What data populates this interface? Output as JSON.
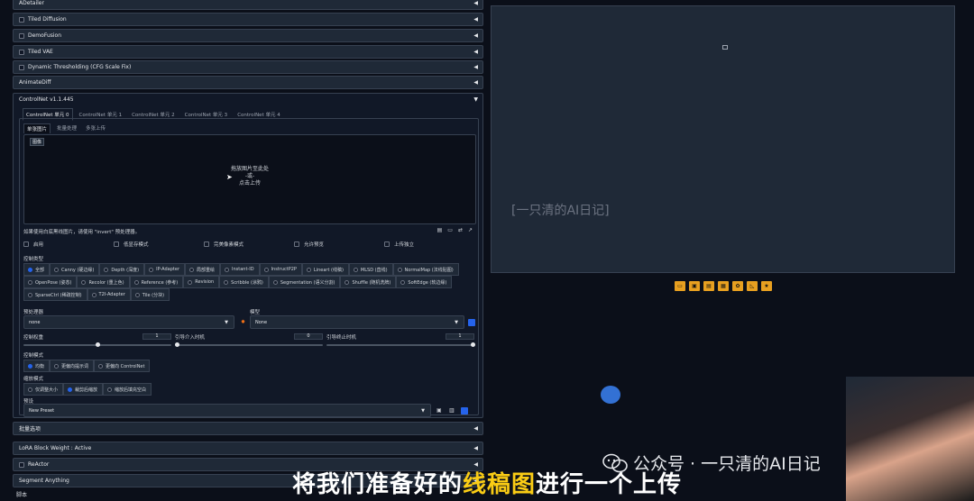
{
  "accordions": [
    {
      "label": "ADetailer",
      "checkbox": false
    },
    {
      "label": "Tiled Diffusion",
      "checkbox": true
    },
    {
      "label": "DemoFusion",
      "checkbox": true
    },
    {
      "label": "Tiled VAE",
      "checkbox": true
    },
    {
      "label": "Dynamic Thresholding (CFG Scale Fix)",
      "checkbox": true
    },
    {
      "label": "AnimateDiff",
      "checkbox": false
    }
  ],
  "controlnet": {
    "title": "ControlNet v1.1.445",
    "units": [
      "ControlNet 单元 0",
      "ControlNet 单元 1",
      "ControlNet 单元 2",
      "ControlNet 单元 3",
      "ControlNet 单元 4"
    ],
    "subtabs": [
      "单张图片",
      "批量处理",
      "多张上传"
    ],
    "image_label": "图像",
    "drop_line1": "拖放图片至此处",
    "drop_line2": "-或-",
    "drop_line3": "点击上传",
    "hint": "如果使用白底黑线图片，请使用 \"invert\" 预处理器。",
    "checks": [
      "启用",
      "低显存模式",
      "完美像素模式",
      "允许预览",
      "上传独立"
    ],
    "control_type_label": "控制类型",
    "control_types": [
      "全部",
      "Canny (硬边缘)",
      "Depth (深度)",
      "IP-Adapter",
      "局部重绘",
      "Instant-ID",
      "InstructP2P",
      "Lineart (线稿)",
      "MLSD (直线)",
      "NormalMap (法线贴图)",
      "OpenPose (姿态)",
      "Recolor (重上色)",
      "Reference (参考)",
      "Revision",
      "Scribble (涂鸦)",
      "Segmentation (语义分割)",
      "Shuffle (随机洗牌)",
      "SoftEdge (软边缘)",
      "SparseCtrl (稀疏控制)",
      "T2I-Adapter",
      "Tile (分块)"
    ],
    "preprocessor_label": "预处理器",
    "preprocessor_value": "none",
    "model_label": "模型",
    "model_value": "None",
    "weight_label": "控制权重",
    "weight_value": "1",
    "start_label": "引导介入时机",
    "start_value": "0",
    "end_label": "引导终止时机",
    "end_value": "1",
    "control_mode_label": "控制模式",
    "control_modes": [
      "均衡",
      "更偏向提示词",
      "更偏向 ControlNet"
    ],
    "resize_label": "缩放模式",
    "resize_modes": [
      "仅调整大小",
      "裁剪后缩放",
      "缩放后填充空白"
    ],
    "preset_label": "预设",
    "preset_value": "New Preset"
  },
  "bottom_accordions": [
    {
      "label": "批量选项",
      "checkbox": false
    },
    {
      "label": "LoRA Block Weight : Active",
      "checkbox": false
    },
    {
      "label": "ReActor",
      "checkbox": true
    },
    {
      "label": "Segment Anything",
      "checkbox": false
    }
  ],
  "script_label": "脚本",
  "gallery_watermark": "[一只清的AI日记]",
  "caption_before": "将我们准备好的",
  "caption_highlight": "线稿图",
  "caption_after": "进行一个上传",
  "wechat_text": "公众号 · 一只清的AI日记",
  "colors": {
    "accent": "#2563eb",
    "highlight": "#facc15",
    "tool_button": "#e8a020"
  }
}
